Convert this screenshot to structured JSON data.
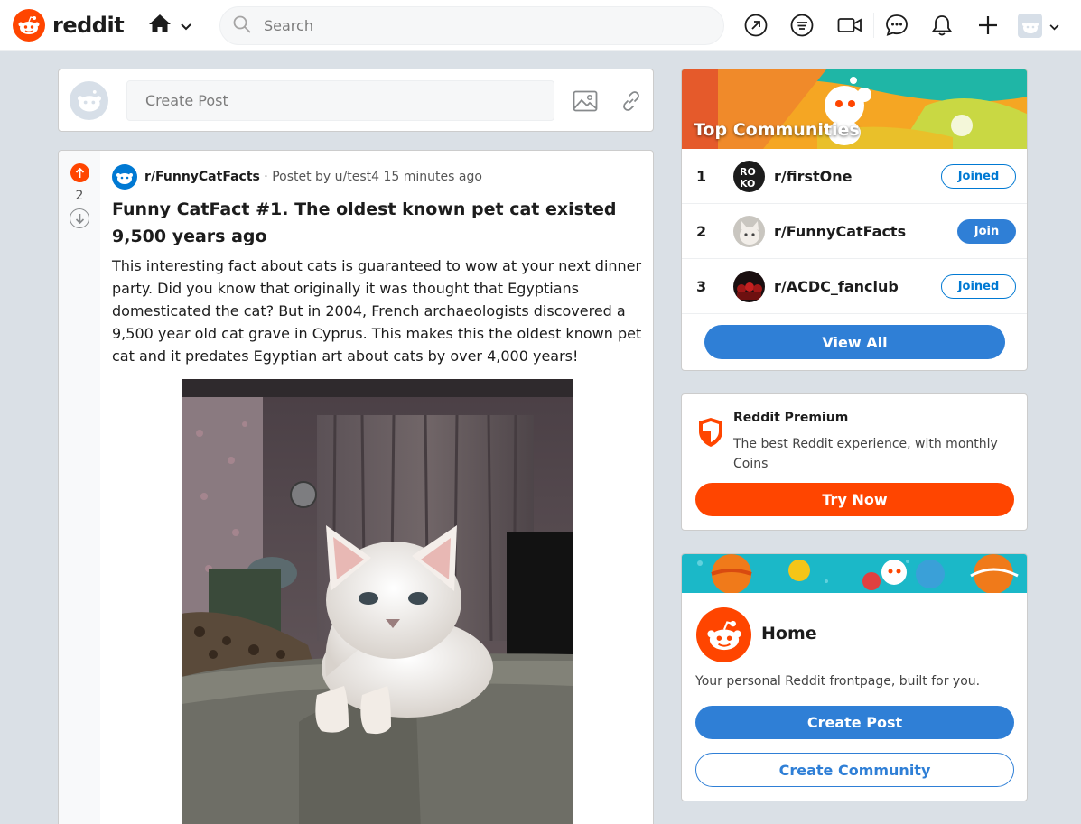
{
  "header": {
    "logo_text": "reddit",
    "search_placeholder": "Search"
  },
  "create_post": {
    "placeholder": "Create Post"
  },
  "post": {
    "vote_count": "2",
    "subreddit": "r/FunnyCatFacts",
    "meta": " · Postet by u/test4 15 minutes ago",
    "title": "Funny CatFact #1. The oldest known pet cat existed 9,500 years ago",
    "body": "This interesting fact about cats is guaranteed to wow at your next dinner party. Did you know that originally it was thought that Egyptians domesticated the cat? But in 2004, French archaeologists discovered a 9,500 year old cat grave in Cyprus. This makes this the oldest known pet cat and it predates Egyptian art about cats by over 4,000 years!"
  },
  "top_communities": {
    "title": "Top Communities",
    "items": [
      {
        "rank": "1",
        "name": "r/firstOne",
        "button": "Joined"
      },
      {
        "rank": "2",
        "name": "r/FunnyCatFacts",
        "button": "Join"
      },
      {
        "rank": "3",
        "name": "r/ACDC_fanclub",
        "button": "Joined"
      }
    ],
    "view_all": "View All"
  },
  "premium": {
    "title": "Reddit Premium",
    "description": "The best Reddit experience, with monthly Coins",
    "button": "Try Now"
  },
  "home_card": {
    "title": "Home",
    "description": "Your personal Reddit frontpage, built for you.",
    "create_post": "Create Post",
    "create_community": "Create Community"
  },
  "colors": {
    "brand_orange": "#ff4500",
    "accent_blue": "#2f7fd6",
    "page_bg": "#dae0e6"
  },
  "icons": [
    "reddit-logo-icon",
    "home-icon",
    "chevron-down-icon",
    "search-icon",
    "popular-icon",
    "coin-feed-icon",
    "video-icon",
    "chat-icon",
    "bell-icon",
    "plus-icon",
    "image-icon",
    "link-icon",
    "upvote-icon",
    "downvote-icon",
    "shield-icon"
  ]
}
